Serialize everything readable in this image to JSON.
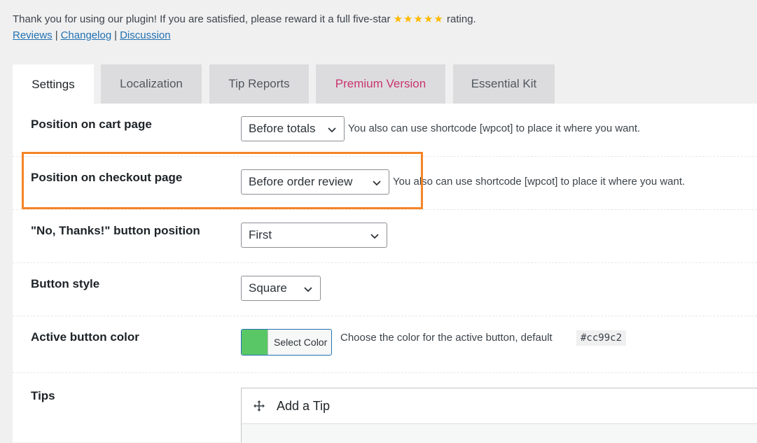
{
  "notice": {
    "text": "Thank you for using our plugin! If you are satisfied, please reward it a full five-star",
    "stars": "★★★★★",
    "suffix": "rating.",
    "links": [
      "Reviews",
      "Changelog",
      "Discussion"
    ],
    "separator": "|"
  },
  "tabs": [
    {
      "label": "Settings",
      "active": true
    },
    {
      "label": "Localization",
      "active": false
    },
    {
      "label": "Tip Reports",
      "active": false
    },
    {
      "label": "Premium Version",
      "active": false
    },
    {
      "label": "Essential Kit",
      "active": false
    }
  ],
  "settings": {
    "cart": {
      "label": "Position on cart page",
      "value": "Before totals",
      "hint": "You also can use shortcode [wpcot] to place it where you want."
    },
    "checkout": {
      "label": "Position on checkout page",
      "value": "Before order review",
      "hint": "You also can use shortcode [wpcot] to place it where you want."
    },
    "no_thanks": {
      "label": "\"No, Thanks!\" button position",
      "value": "First"
    },
    "button_style": {
      "label": "Button style",
      "value": "Square"
    },
    "active_color": {
      "label": "Active button color",
      "button_label": "Select Color",
      "swatch": "#5ac766",
      "hint": "Choose the color for the active button, default",
      "default": "#cc99c2"
    },
    "tips": {
      "label": "Tips",
      "add_label": "Add a Tip"
    }
  },
  "colors": {
    "highlight": "#f58426",
    "link": "#2271b1",
    "premium": "#c9356e",
    "star": "#ffb900"
  }
}
